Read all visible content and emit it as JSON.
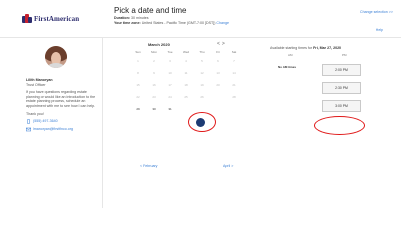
{
  "brand": {
    "logo_text": "FirstAmerican"
  },
  "header": {
    "help_label": "Help"
  },
  "profile": {
    "name": "Lilith Manoryan",
    "role": "Trust Officer",
    "blurb": "If you have questions regarding estate planning or would like an introduction to the estate planning process, schedule an appointment with me to see how I can help.",
    "thanks": "Thank you!",
    "phone": "(555) 497-3640",
    "email": "lmanoryan@firstfinco.org"
  },
  "scheduler": {
    "title": "Pick a date and time",
    "duration_label": "Duration:",
    "duration_value": "30 minutes",
    "timezone_label": "Your time zone:",
    "timezone_value": "United States - Pacific Time (GMT-7:00 [DST])",
    "timezone_change": "Change",
    "change_selection": "Change selection >>"
  },
  "calendar": {
    "month": "March 2020",
    "nav_prev": "<",
    "nav_next": ">",
    "days_of_week": [
      "Sun",
      "Mon",
      "Tue",
      "Wed",
      "Thu",
      "Fri",
      "Sat"
    ],
    "weeks": [
      [
        "1",
        "2",
        "3",
        "4",
        "5",
        "6",
        "7"
      ],
      [
        "8",
        "9",
        "10",
        "11",
        "12",
        "13",
        "14"
      ],
      [
        "15",
        "16",
        "17",
        "18",
        "19",
        "20",
        "21"
      ],
      [
        "22",
        "23",
        "24",
        "25",
        "26",
        "27",
        "28"
      ],
      [
        "29",
        "30",
        "31",
        "",
        "",
        "",
        ""
      ]
    ],
    "selected_day": "27",
    "prev_link": "< February",
    "next_link": "April >"
  },
  "times": {
    "heading_prefix": "Available starting times for",
    "heading_date": "Fri, Mar 27, 2020",
    "col1": "AM",
    "col2": "PM",
    "no_am": "No AM times",
    "slots": [
      "2:00 PM",
      "2:30 PM",
      "3:00 PM"
    ],
    "highlighted_slot": "3:00 PM"
  },
  "annotation_color": "#e01818",
  "accent_color": "#3a7fd5"
}
